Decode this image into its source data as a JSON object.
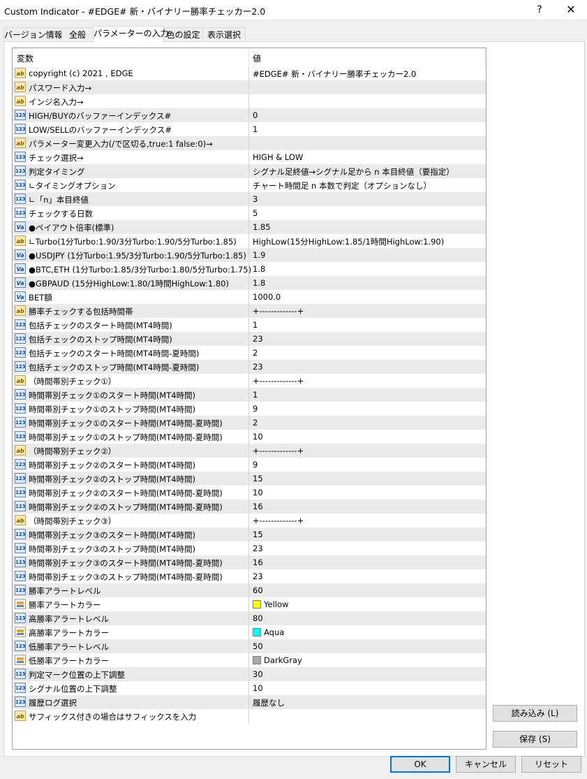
{
  "window": {
    "title": "Custom Indicator - #EDGE# 新・バイナリー勝率チェッカー2.0",
    "help_label": "?",
    "close_label": "✕"
  },
  "tabs": [
    {
      "label": "バージョン情報"
    },
    {
      "label": "全般"
    },
    {
      "label": "パラメーターの入力",
      "active": true
    },
    {
      "label": "色の設定"
    },
    {
      "label": "表示選択"
    }
  ],
  "grid": {
    "columns": {
      "variable": "変数",
      "value": "値"
    },
    "icon_glyphs": {
      "ab": "ab",
      "num": "123",
      "dbl": "Va"
    },
    "rows": [
      {
        "icon": "ab",
        "name": "copyright (c) 2021 , EDGE",
        "value": "#EDGE# 新・バイナリー勝率チェッカー2.0"
      },
      {
        "icon": "ab",
        "name": "パスワード入力→",
        "value": ""
      },
      {
        "icon": "ab",
        "name": "インジ名入力→",
        "value": ""
      },
      {
        "icon": "num",
        "name": "HIGH/BUYのバッファーインデックス#",
        "value": "0"
      },
      {
        "icon": "num",
        "name": "LOW/SELLのバッファーインデックス#",
        "value": "1"
      },
      {
        "icon": "ab",
        "name": "パラメーター変更入力(/で区切る,true:1 false:0)→",
        "value": ""
      },
      {
        "icon": "num",
        "name": "チェック選択→",
        "value": "HIGH & LOW"
      },
      {
        "icon": "num",
        "name": "判定タイミング",
        "value": "シグナル足終値→シグナル足から n 本目終値（要指定）"
      },
      {
        "icon": "num",
        "name": "∟タイミングオプション",
        "value": "チャート時間足 n 本数で判定（オプションなし）"
      },
      {
        "icon": "num",
        "name": "∟「n」本目終値",
        "value": "3"
      },
      {
        "icon": "num",
        "name": "チェックする日数",
        "value": "5"
      },
      {
        "icon": "dbl",
        "name": "●ペイアウト倍率(標準)",
        "value": "1.85"
      },
      {
        "icon": "ab",
        "name": "∟Turbo(1分Turbo:1.90/3分Turbo:1.90/5分Turbo:1.85)",
        "value": "HighLow(15分HighLow:1.85/1時間HighLow:1.90)"
      },
      {
        "icon": "dbl",
        "name": "●USDJPY (1分Turbo:1.95/3分Turbo:1.90/5分Turbo:1.85)",
        "value": "1.9"
      },
      {
        "icon": "dbl",
        "name": "●BTC,ETH (1分Turbo:1.85/3分Turbo:1.80/5分Turbo:1.75)",
        "value": "1.8"
      },
      {
        "icon": "dbl",
        "name": "●GBPAUD (15分HighLow:1.80/1時間HighLow:1.80)",
        "value": "1.8"
      },
      {
        "icon": "dbl",
        "name": "BET額",
        "value": "1000.0"
      },
      {
        "icon": "ab",
        "name": "勝率チェックする包括時間帯",
        "value": "+-------------+"
      },
      {
        "icon": "num",
        "name": "包括チェックのスタート時間(MT4時間)",
        "value": "1"
      },
      {
        "icon": "num",
        "name": "包括チェックのストップ時間(MT4時間)",
        "value": "23"
      },
      {
        "icon": "num",
        "name": "包括チェックのスタート時間(MT4時間-夏時間)",
        "value": "2"
      },
      {
        "icon": "num",
        "name": "包括チェックのストップ時間(MT4時間-夏時間)",
        "value": "23"
      },
      {
        "icon": "ab",
        "name": "（時間帯別チェック①）",
        "value": "+-------------+"
      },
      {
        "icon": "num",
        "name": "時間帯別チェック①のスタート時間(MT4時間)",
        "value": "1"
      },
      {
        "icon": "num",
        "name": "時間帯別チェック①のストップ時間(MT4時間)",
        "value": "9"
      },
      {
        "icon": "num",
        "name": "時間帯別チェック①のスタート時間(MT4時間-夏時間)",
        "value": "2"
      },
      {
        "icon": "num",
        "name": "時間帯別チェック①のストップ時間(MT4時間-夏時間)",
        "value": "10"
      },
      {
        "icon": "ab",
        "name": "（時間帯別チェック②）",
        "value": "+-------------+"
      },
      {
        "icon": "num",
        "name": "時間帯別チェック②のスタート時間(MT4時間)",
        "value": "9"
      },
      {
        "icon": "num",
        "name": "時間帯別チェック②のストップ時間(MT4時間)",
        "value": "15"
      },
      {
        "icon": "num",
        "name": "時間帯別チェック②のスタート時間(MT4時間-夏時間)",
        "value": "10"
      },
      {
        "icon": "num",
        "name": "時間帯別チェック②のストップ時間(MT4時間-夏時間)",
        "value": "16"
      },
      {
        "icon": "ab",
        "name": "（時間帯別チェック③）",
        "value": "+-------------+"
      },
      {
        "icon": "num",
        "name": "時間帯別チェック③のスタート時間(MT4時間)",
        "value": "15"
      },
      {
        "icon": "num",
        "name": "時間帯別チェック③のストップ時間(MT4時間)",
        "value": "23"
      },
      {
        "icon": "num",
        "name": "時間帯別チェック③のスタート時間(MT4時間-夏時間)",
        "value": "16"
      },
      {
        "icon": "num",
        "name": "時間帯別チェック③のストップ時間(MT4時間-夏時間)",
        "value": "23"
      },
      {
        "icon": "num",
        "name": "勝率アラートレベル",
        "value": "60"
      },
      {
        "icon": "color",
        "name": "勝率アラートカラー",
        "value": "Yellow",
        "swatch": "#ffff00"
      },
      {
        "icon": "num",
        "name": "高勝率アラートレベル",
        "value": "80"
      },
      {
        "icon": "color",
        "name": "高勝率アラートカラー",
        "value": "Aqua",
        "swatch": "#00ffff"
      },
      {
        "icon": "num",
        "name": "低勝率アラートレベル",
        "value": "50"
      },
      {
        "icon": "color",
        "name": "低勝率アラートカラー",
        "value": "DarkGray",
        "swatch": "#a9a9a9"
      },
      {
        "icon": "num",
        "name": "判定マーク位置の上下調整",
        "value": "30"
      },
      {
        "icon": "num",
        "name": "シグナル位置の上下調整",
        "value": "10"
      },
      {
        "icon": "num",
        "name": "履歴ログ選択",
        "value": "履歴なし"
      },
      {
        "icon": "ab",
        "name": "サフィックス付きの場合はサフィックスを入力",
        "value": ""
      }
    ]
  },
  "side_buttons": {
    "load": "読み込み (L)",
    "save": "保存 (S)"
  },
  "footer_buttons": {
    "ok": "OK",
    "cancel": "キャンセル",
    "reset": "リセット"
  }
}
